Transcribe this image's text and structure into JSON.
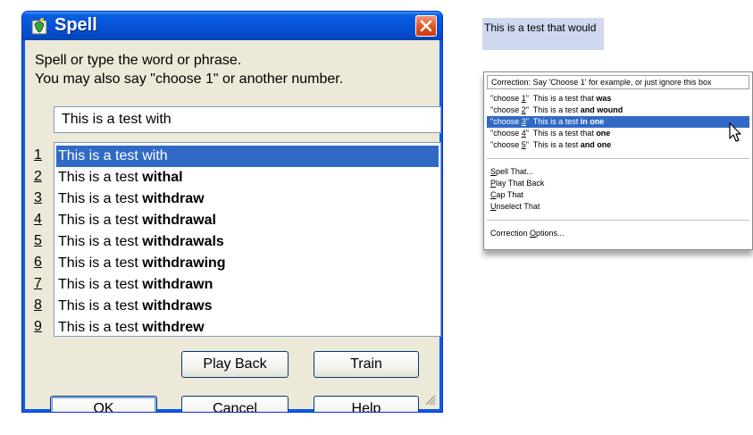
{
  "dialog": {
    "title": "Spell",
    "instructions": {
      "line1": "Spell or type the word or phrase.",
      "line2": "You may also say \"choose 1\" or another number."
    },
    "input_value": "This is a test with",
    "candidates": [
      {
        "num": "1",
        "prefix": "This is a test with",
        "bold": "",
        "selected": true
      },
      {
        "num": "2",
        "prefix": "This is a test ",
        "bold": "withal",
        "selected": false
      },
      {
        "num": "3",
        "prefix": "This is a test ",
        "bold": "withdraw",
        "selected": false
      },
      {
        "num": "4",
        "prefix": "This is a test ",
        "bold": "withdrawal",
        "selected": false
      },
      {
        "num": "5",
        "prefix": "This is a test ",
        "bold": "withdrawals",
        "selected": false
      },
      {
        "num": "6",
        "prefix": "This is a test ",
        "bold": "withdrawing",
        "selected": false
      },
      {
        "num": "7",
        "prefix": "This is a test ",
        "bold": "withdrawn",
        "selected": false
      },
      {
        "num": "8",
        "prefix": "This is a test ",
        "bold": "withdraws",
        "selected": false
      },
      {
        "num": "9",
        "prefix": "This is a test ",
        "bold": "withdrew",
        "selected": false
      }
    ],
    "buttons": {
      "play_back": "Play Back",
      "train": "Train",
      "ok": "OK",
      "cancel": "Cancel",
      "help": "Help"
    }
  },
  "dictated_text": "This is a test that would",
  "correction_menu": {
    "header": "Correction: Say 'Choose 1' for example, or just ignore this box",
    "options": [
      {
        "choose_pre": "\"choose ",
        "num": "1",
        "choose_post": "\"",
        "prefix": "  This is a test that ",
        "bold": "was",
        "highlighted": false
      },
      {
        "choose_pre": "\"choose ",
        "num": "2",
        "choose_post": "\"",
        "prefix": "  This is a test ",
        "bold": "and wound",
        "highlighted": false
      },
      {
        "choose_pre": "\"choose ",
        "num": "3",
        "choose_post": "\"",
        "prefix": "  This is a test ",
        "bold": "in one",
        "highlighted": true
      },
      {
        "choose_pre": "\"choose ",
        "num": "4",
        "choose_post": "\"",
        "prefix": "  This is a test that ",
        "bold": "one",
        "highlighted": false
      },
      {
        "choose_pre": "\"choose ",
        "num": "5",
        "choose_post": "\"",
        "prefix": "  This is a test ",
        "bold": "and one",
        "highlighted": false
      }
    ],
    "commands": [
      {
        "key": "S",
        "rest": "pell That..."
      },
      {
        "key": "P",
        "rest": "lay That Back"
      },
      {
        "key": "C",
        "rest": "ap That"
      },
      {
        "key": "U",
        "rest": "nselect That"
      }
    ],
    "options_item": {
      "pre": "Correction ",
      "key": "O",
      "rest": "ptions..."
    }
  },
  "colors": {
    "titlebar": "#0653d8",
    "selection": "#316ac5",
    "close_button": "#e2521f",
    "dialog_face": "#ece9d8",
    "dictated_highlight": "#cfd8ef"
  },
  "icons": [
    "app-icon",
    "close-icon",
    "resize-grip-icon",
    "mouse-cursor-icon"
  ]
}
